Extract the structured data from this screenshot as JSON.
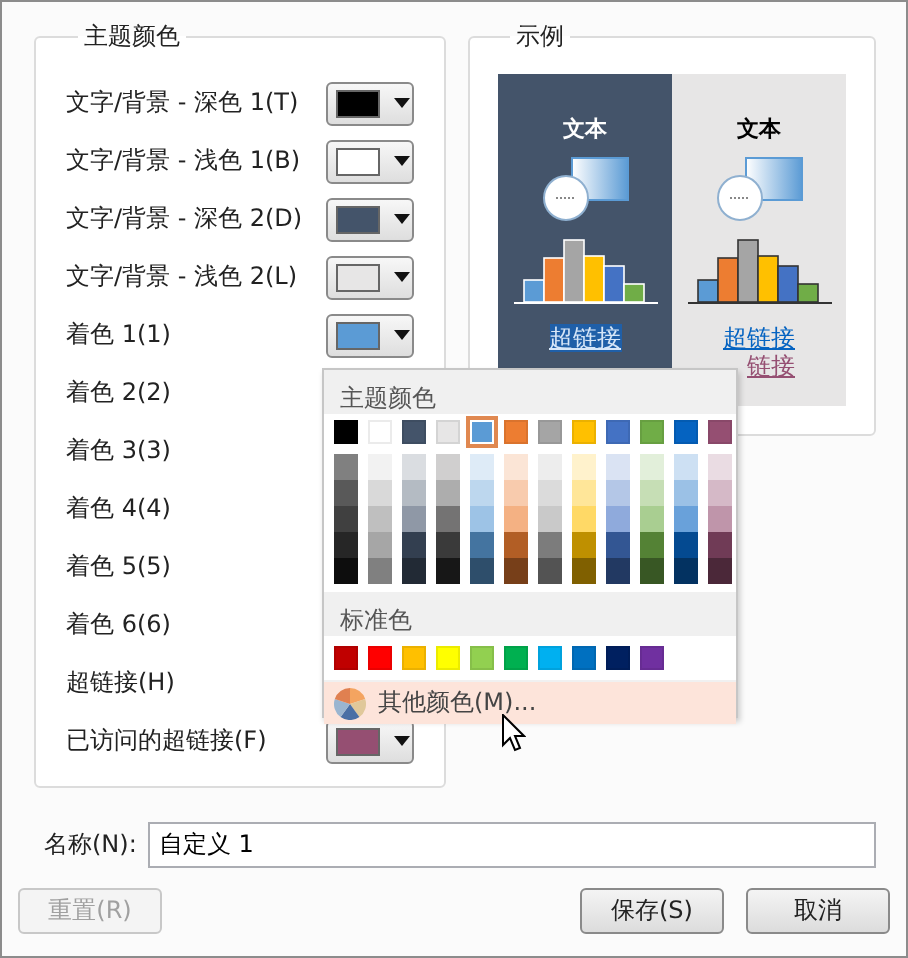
{
  "theme_group": {
    "title": "主题颜色",
    "rows": [
      {
        "label": "文字/背景 - 深色 1(T)",
        "color": "#000000"
      },
      {
        "label": "文字/背景 - 浅色 1(B)",
        "color": "#ffffff"
      },
      {
        "label": "文字/背景 - 深色 2(D)",
        "color": "#44546a"
      },
      {
        "label": "文字/背景 - 浅色 2(L)",
        "color": "#e7e6e6"
      },
      {
        "label": "着色 1(1)",
        "color": "#5b9bd5"
      },
      {
        "label": "着色 2(2)"
      },
      {
        "label": "着色 3(3)"
      },
      {
        "label": "着色 4(4)"
      },
      {
        "label": "着色 5(5)"
      },
      {
        "label": "着色 6(6)"
      },
      {
        "label": "超链接(H)"
      },
      {
        "label": "已访问的超链接(F)",
        "color": "#954f72"
      }
    ]
  },
  "sample_group": {
    "title": "示例",
    "dark_panel": {
      "heading": "文本",
      "link": "超链接"
    },
    "light_panel": {
      "heading": "文本",
      "link": "超链接",
      "visited_link": "链接"
    }
  },
  "color_menu": {
    "theme_title": "主题颜色",
    "theme_colors": [
      {
        "color": "#000000",
        "selected": false
      },
      {
        "color": "#ffffff",
        "selected": false
      },
      {
        "color": "#44546a",
        "selected": false
      },
      {
        "color": "#e7e6e6",
        "selected": false
      },
      {
        "color": "#5b9bd5",
        "selected": true
      },
      {
        "color": "#ed7d31",
        "selected": false
      },
      {
        "color": "#a5a5a5",
        "selected": false
      },
      {
        "color": "#ffc000",
        "selected": false
      },
      {
        "color": "#4472c4",
        "selected": false
      },
      {
        "color": "#70ad47",
        "selected": false
      },
      {
        "color": "#0563c1",
        "selected": false
      },
      {
        "color": "#954f72",
        "selected": false
      }
    ],
    "standard_title": "标准色",
    "standard_colors": [
      {
        "color": "#c00000"
      },
      {
        "color": "#ff0000"
      },
      {
        "color": "#ffc000"
      },
      {
        "color": "#ffff00"
      },
      {
        "color": "#92d050"
      },
      {
        "color": "#00b050"
      },
      {
        "color": "#00b0f0"
      },
      {
        "color": "#0070c0"
      },
      {
        "color": "#002060"
      },
      {
        "color": "#7030a0"
      }
    ],
    "more_colors": {
      "label": "其他颜色(M)...",
      "highlighted": true
    }
  },
  "name_field": {
    "label": "名称(N):",
    "value": "自定义 1"
  },
  "buttons": [
    {
      "label": "重置(R)",
      "disabled": true
    },
    {
      "label": "保存(S)",
      "disabled": false
    },
    {
      "label": "取消",
      "disabled": false
    }
  ]
}
